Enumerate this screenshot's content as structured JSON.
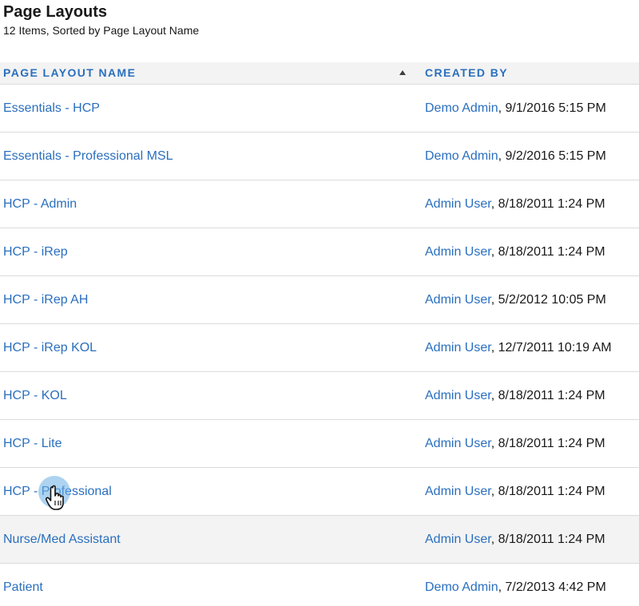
{
  "header": {
    "title": "Page Layouts",
    "subtitle": "12 Items, Sorted by Page Layout Name"
  },
  "table": {
    "columns": {
      "name": "PAGE LAYOUT NAME",
      "created_by": "CREATED BY"
    },
    "rows": [
      {
        "name": "Essentials - HCP",
        "user": "Demo Admin",
        "date": ", 9/1/2016 5:15 PM"
      },
      {
        "name": "Essentials - Professional MSL",
        "user": "Demo Admin",
        "date": ", 9/2/2016 5:15 PM"
      },
      {
        "name": "HCP - Admin",
        "user": "Admin User",
        "date": ", 8/18/2011 1:24 PM"
      },
      {
        "name": "HCP - iRep",
        "user": "Admin User",
        "date": ", 8/18/2011 1:24 PM"
      },
      {
        "name": "HCP - iRep AH",
        "user": "Admin User",
        "date": ", 5/2/2012 10:05 PM"
      },
      {
        "name": "HCP - iRep KOL",
        "user": "Admin User",
        "date": ", 12/7/2011 10:19 AM"
      },
      {
        "name": "HCP - KOL",
        "user": "Admin User",
        "date": ", 8/18/2011 1:24 PM"
      },
      {
        "name": "HCP - Lite",
        "user": "Admin User",
        "date": ", 8/18/2011 1:24 PM"
      },
      {
        "name": "HCP - Professional",
        "user": "Admin User",
        "date": ", 8/18/2011 1:24 PM"
      },
      {
        "name": "Nurse/Med Assistant",
        "user": "Admin User",
        "date": ", 8/18/2011 1:24 PM"
      },
      {
        "name": "Patient",
        "user": "Demo Admin",
        "date": ", 7/2/2013 4:42 PM"
      }
    ]
  },
  "colors": {
    "link": "#2a6fbe",
    "header_bg": "#f3f3f3",
    "border": "#dddbda"
  },
  "icons": {
    "sort": "sort-ascending-icon",
    "cursor": "hand-pointer-cursor-icon"
  }
}
